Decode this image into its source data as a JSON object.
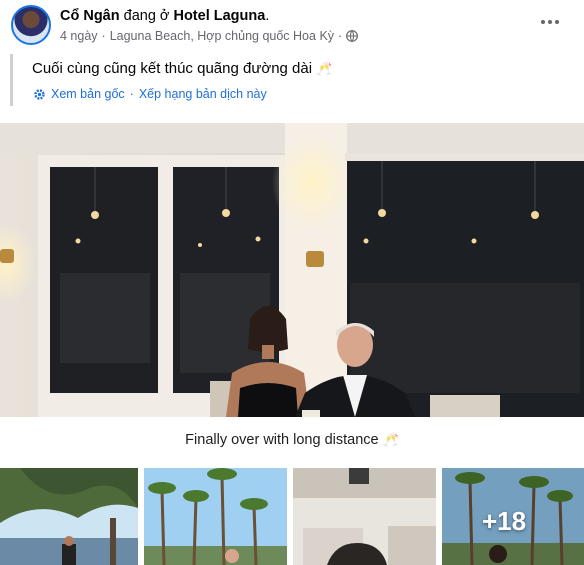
{
  "post": {
    "author_name": "Cổ Ngân",
    "status_verb": "đang ở",
    "place_name": "Hotel Laguna",
    "place_suffix": ".",
    "time_ago": "4 ngày",
    "location": "Laguna Beach, Hợp chủng quốc Hoa Kỳ",
    "separator": "·",
    "privacy_icon": "globe-icon"
  },
  "translation": {
    "text": "Cuối cùng cũng kết thúc quãng đường dài",
    "emoji": "🥂",
    "see_original": "Xem bản gốc",
    "separator": "·",
    "rate_translation": "Xếp hạng bản dịch này"
  },
  "photo_caption": {
    "text": "Finally over with long distance",
    "emoji": "🥂"
  },
  "thumbnails": {
    "more_count": "+18"
  },
  "colors": {
    "link_blue": "#216fdb",
    "secondary_text": "#65676b",
    "avatar_ring": "#1b74e4"
  }
}
